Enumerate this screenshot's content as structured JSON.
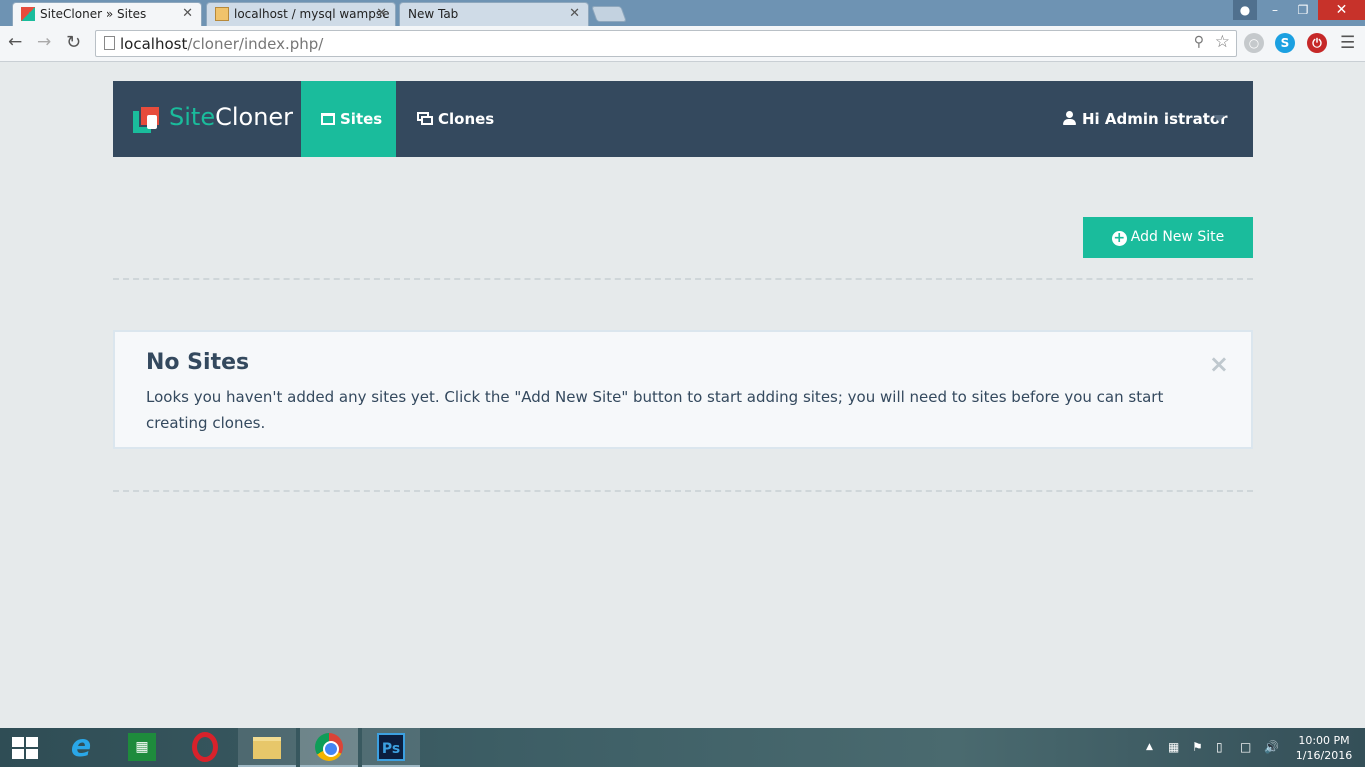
{
  "browser": {
    "tabs": [
      {
        "title": "SiteCloner » Sites",
        "favicon": "sitecloner-favicon",
        "active": true
      },
      {
        "title": "localhost / mysql wampse",
        "favicon": "phpmyadmin-favicon",
        "active": false
      },
      {
        "title": "New Tab",
        "favicon": "",
        "active": false
      }
    ],
    "url_host": "localhost",
    "url_path": "/cloner/index.php/",
    "window_controls": {
      "minimize": "–",
      "maximize": "❐",
      "close": "✕"
    }
  },
  "app": {
    "brand": {
      "part1": "Site",
      "part2": "Cloner"
    },
    "nav": {
      "sites_label": "Sites",
      "clones_label": "Clones",
      "user_label": "Hi Admin istrator"
    },
    "colors": {
      "navbar": "#34495e",
      "accent": "#1abc9c",
      "brand_red": "#e74c3c"
    }
  },
  "content": {
    "add_button_label": "Add New Site",
    "alert": {
      "title": "No Sites",
      "body": "Looks you haven't added any sites yet. Click the \"Add New Site\" button to start adding sites; you will need to sites before you can start creating clones.",
      "close_glyph": "×"
    }
  },
  "taskbar": {
    "apps": [
      "internet-explorer",
      "windows-store",
      "opera",
      "file-explorer",
      "chrome",
      "photoshop"
    ],
    "ps_label": "Ps",
    "clock_time": "10:00 PM",
    "clock_date": "1/16/2016"
  }
}
